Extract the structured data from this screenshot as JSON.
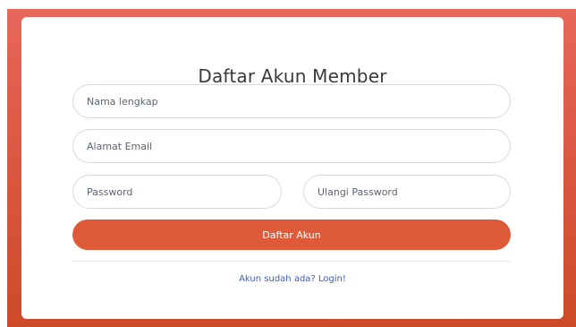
{
  "form": {
    "title": "Daftar Akun Member",
    "fields": {
      "full_name": {
        "value": "",
        "placeholder": "Nama lengkap"
      },
      "email": {
        "value": "",
        "placeholder": "Alamat Email"
      },
      "password": {
        "value": "",
        "placeholder": "Password"
      },
      "repeat_password": {
        "value": "",
        "placeholder": "Ulangi Password"
      }
    },
    "submit_label": "Daftar Akun",
    "login_link": "Akun sudah ada? Login!"
  },
  "colors": {
    "background_top": "#e8665a",
    "background_bottom": "#cf4a28",
    "button": "#df5a38",
    "link": "#3a5bd0"
  }
}
